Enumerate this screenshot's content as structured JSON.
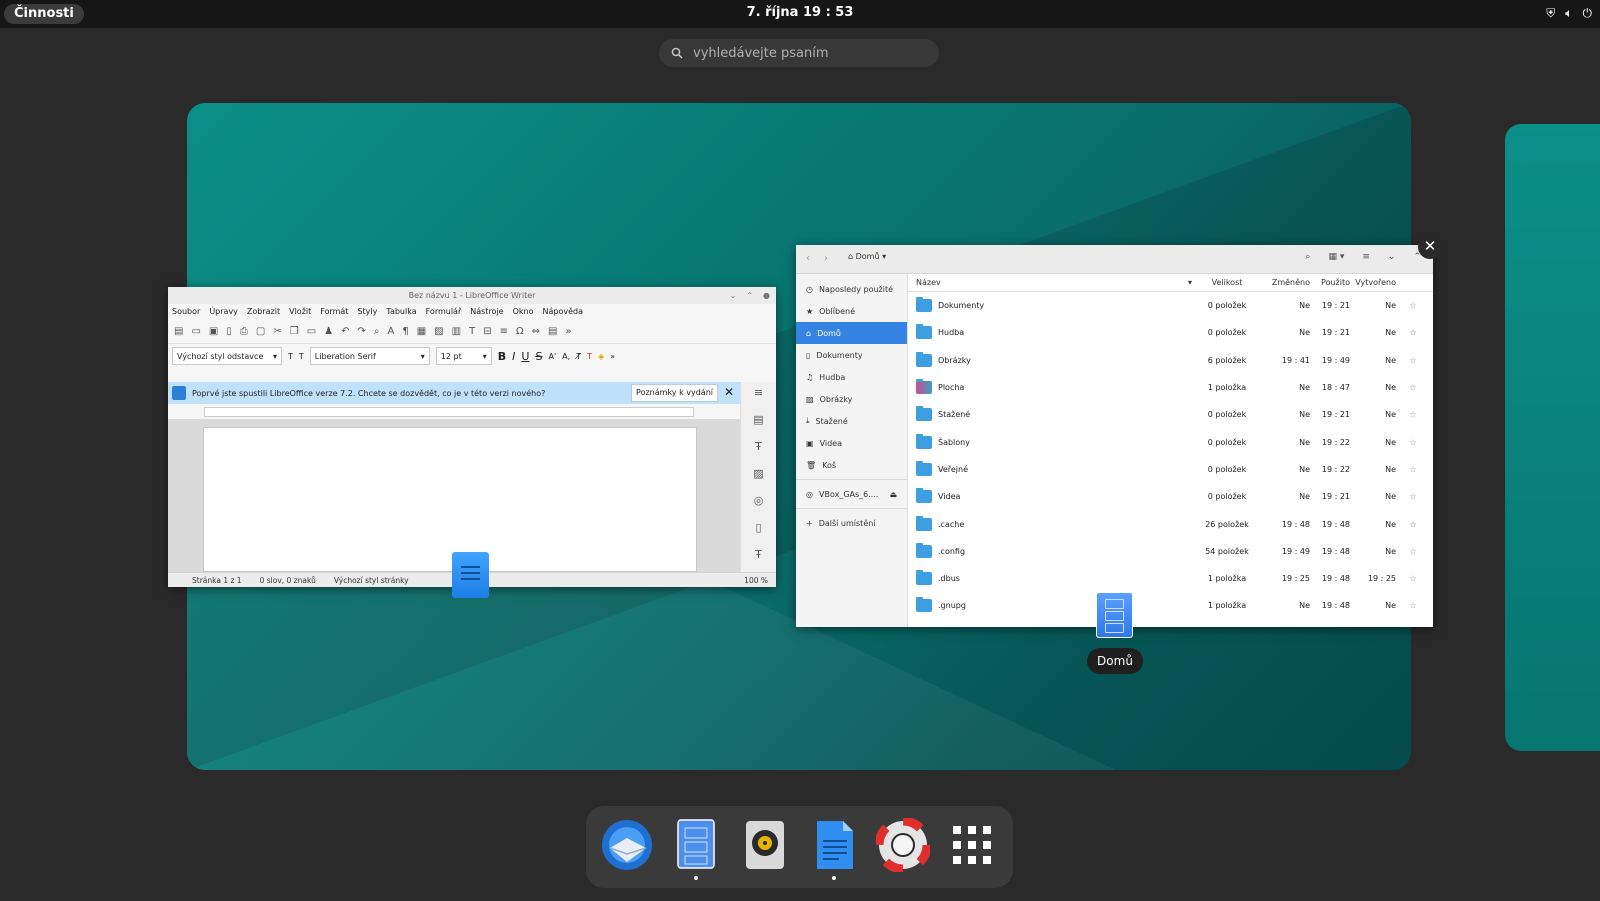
{
  "topbar": {
    "activities": "Činnosti",
    "clock": "7. října  19 : 53"
  },
  "search": {
    "placeholder": "vyhledávejte psaním"
  },
  "writer": {
    "title": "Bez názvu 1 - LibreOffice Writer",
    "menu": [
      "Soubor",
      "Úpravy",
      "Zobrazit",
      "Vložit",
      "Formát",
      "Styly",
      "Tabulka",
      "Formulář",
      "Nástroje",
      "Okno",
      "Nápověda"
    ],
    "paragraph_style": "Výchozí styl odstavce",
    "font_name": "Liberation Serif",
    "font_size": "12 pt",
    "infobar_text": "Poprvé jste spustili LibreOffice verze 7.2. Chcete se dozvědět, co je v této verzi nového?",
    "release_notes_button": "Poznámky k vydání",
    "status": {
      "page": "Stránka 1 z 1",
      "words": "0 slov, 0 znaků",
      "page_style": "Výchozí styl stránky",
      "zoom": "100 %"
    }
  },
  "files": {
    "path": "Domů",
    "sidebar": [
      {
        "label": "Naposledy použité",
        "icon": "clock-icon"
      },
      {
        "label": "Oblíbené",
        "icon": "star-icon"
      },
      {
        "label": "Domů",
        "icon": "home-icon",
        "active": true
      },
      {
        "label": "Dokumenty",
        "icon": "document-icon"
      },
      {
        "label": "Hudba",
        "icon": "music-icon"
      },
      {
        "label": "Obrázky",
        "icon": "image-icon"
      },
      {
        "label": "Stažené",
        "icon": "download-icon"
      },
      {
        "label": "Videa",
        "icon": "video-icon"
      },
      {
        "label": "Koš",
        "icon": "trash-icon"
      },
      {
        "label": "VBox_GAs_6....",
        "icon": "disc-icon"
      },
      {
        "label": "Další umístění",
        "icon": "plus-icon"
      }
    ],
    "columns": {
      "name": "Název",
      "size": "Velikost",
      "modified": "Změněno",
      "used": "Použito",
      "created": "Vytvořeno"
    },
    "rows": [
      {
        "name": "Dokumenty",
        "size": "0 položek",
        "modified": "Ne",
        "used": "19 : 21",
        "created": "Ne"
      },
      {
        "name": "Hudba",
        "size": "0 položek",
        "modified": "Ne",
        "used": "19 : 21",
        "created": "Ne"
      },
      {
        "name": "Obrázky",
        "size": "6 položek",
        "modified": "19 : 41",
        "used": "19 : 49",
        "created": "Ne"
      },
      {
        "name": "Plocha",
        "size": "1 položka",
        "modified": "Ne",
        "used": "18 : 47",
        "created": "Ne"
      },
      {
        "name": "Stažené",
        "size": "0 položek",
        "modified": "Ne",
        "used": "19 : 21",
        "created": "Ne"
      },
      {
        "name": "Šablony",
        "size": "0 položek",
        "modified": "Ne",
        "used": "19 : 22",
        "created": "Ne"
      },
      {
        "name": "Veřejné",
        "size": "0 položek",
        "modified": "Ne",
        "used": "19 : 22",
        "created": "Ne"
      },
      {
        "name": "Videa",
        "size": "0 položek",
        "modified": "Ne",
        "used": "19 : 21",
        "created": "Ne"
      },
      {
        "name": ".cache",
        "size": "26 položek",
        "modified": "19 : 48",
        "used": "19 : 48",
        "created": "Ne"
      },
      {
        "name": ".config",
        "size": "54 položek",
        "modified": "19 : 49",
        "used": "19 : 48",
        "created": "Ne"
      },
      {
        "name": ".dbus",
        "size": "1 položka",
        "modified": "19 : 25",
        "used": "19 : 48",
        "created": "19 : 25"
      },
      {
        "name": ".gnupg",
        "size": "1 položka",
        "modified": "Ne",
        "used": "19 : 48",
        "created": "Ne"
      }
    ]
  },
  "tooltip": "Domů",
  "dock": [
    "thunderbird-icon",
    "files-icon",
    "rhythmbox-icon",
    "writer-icon",
    "help-icon",
    "app-grid-icon"
  ]
}
